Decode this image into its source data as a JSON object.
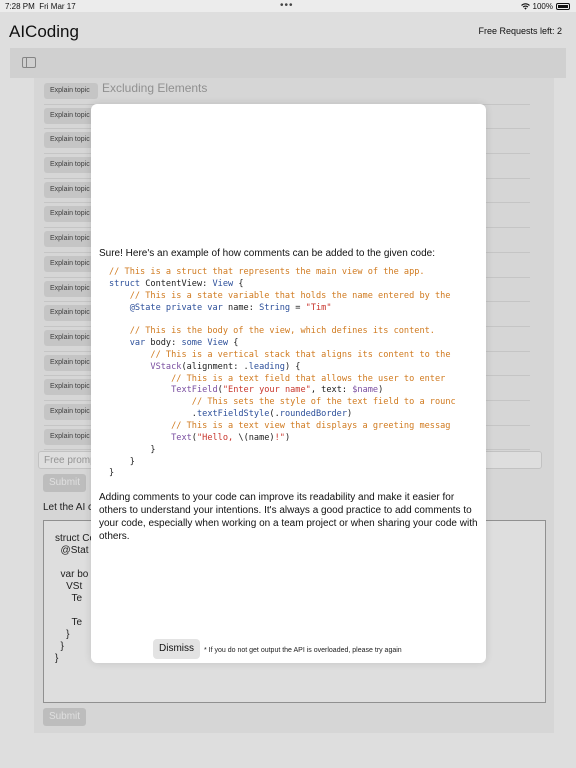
{
  "status_bar": {
    "time": "7:28 PM",
    "date": "Fri Mar 17",
    "battery": "100%"
  },
  "header": {
    "app_title": "AICoding",
    "free_requests": "Free Requests left: 2"
  },
  "topics": {
    "button_label": "Explain topic",
    "first_topic": "Excluding Elements",
    "row_count": 15
  },
  "free_prompt": {
    "placeholder": "Free promp"
  },
  "submit_label": "Submit",
  "let_ai_label": "Let the AI c",
  "background_code": [
    "struct Co",
    "  @Stat",
    "",
    "  var bo",
    "    VSt",
    "      Te",
    "",
    "      Te",
    "    }",
    "  }",
    "}"
  ],
  "modal": {
    "intro": "Sure! Here's an example of how comments can be added to the given code:",
    "code_lines": [
      [
        {
          "t": "c",
          "v": "// This is a struct that represents the main view of the app."
        }
      ],
      [
        {
          "t": "k",
          "v": "struct"
        },
        {
          "t": "n",
          "v": " ContentView: "
        },
        {
          "t": "t",
          "v": "View"
        },
        {
          "t": "n",
          "v": " {"
        }
      ],
      [
        {
          "t": "n",
          "v": "    "
        },
        {
          "t": "c",
          "v": "// This is a state variable that holds the name entered by the"
        }
      ],
      [
        {
          "t": "n",
          "v": "    "
        },
        {
          "t": "k",
          "v": "@State private var"
        },
        {
          "t": "n",
          "v": " name: "
        },
        {
          "t": "t",
          "v": "String"
        },
        {
          "t": "n",
          "v": " = "
        },
        {
          "t": "s",
          "v": "\"Tim\""
        }
      ],
      [
        {
          "t": "n",
          "v": ""
        }
      ],
      [
        {
          "t": "n",
          "v": "    "
        },
        {
          "t": "c",
          "v": "// This is the body of the view, which defines its content."
        }
      ],
      [
        {
          "t": "n",
          "v": "    "
        },
        {
          "t": "k",
          "v": "var"
        },
        {
          "t": "n",
          "v": " body: "
        },
        {
          "t": "k",
          "v": "some"
        },
        {
          "t": "n",
          "v": " "
        },
        {
          "t": "t",
          "v": "View"
        },
        {
          "t": "n",
          "v": " {"
        }
      ],
      [
        {
          "t": "n",
          "v": "        "
        },
        {
          "t": "c",
          "v": "// This is a vertical stack that aligns its content to the"
        }
      ],
      [
        {
          "t": "n",
          "v": "        "
        },
        {
          "t": "v",
          "v": "VStack"
        },
        {
          "t": "n",
          "v": "(alignment: ."
        },
        {
          "t": "p",
          "v": "leading"
        },
        {
          "t": "n",
          "v": ") {"
        }
      ],
      [
        {
          "t": "n",
          "v": "            "
        },
        {
          "t": "c",
          "v": "// This is a text field that allows the user to enter"
        }
      ],
      [
        {
          "t": "n",
          "v": "            "
        },
        {
          "t": "v",
          "v": "TextField"
        },
        {
          "t": "n",
          "v": "("
        },
        {
          "t": "s",
          "v": "\"Enter your name\""
        },
        {
          "t": "n",
          "v": ", text: "
        },
        {
          "t": "v",
          "v": "$name"
        },
        {
          "t": "n",
          "v": ")"
        }
      ],
      [
        {
          "t": "n",
          "v": "                "
        },
        {
          "t": "c",
          "v": "// This sets the style of the text field to a rounc"
        }
      ],
      [
        {
          "t": "n",
          "v": "                ."
        },
        {
          "t": "p",
          "v": "textFieldStyle"
        },
        {
          "t": "n",
          "v": "(."
        },
        {
          "t": "p",
          "v": "roundedBorder"
        },
        {
          "t": "n",
          "v": ")"
        }
      ],
      [
        {
          "t": "n",
          "v": "            "
        },
        {
          "t": "c",
          "v": "// This is a text view that displays a greeting messag"
        }
      ],
      [
        {
          "t": "n",
          "v": "            "
        },
        {
          "t": "v",
          "v": "Text"
        },
        {
          "t": "n",
          "v": "("
        },
        {
          "t": "s",
          "v": "\"Hello, "
        },
        {
          "t": "n",
          "v": "\\(name)"
        },
        {
          "t": "s",
          "v": "!\""
        },
        {
          "t": "n",
          "v": ")"
        }
      ],
      [
        {
          "t": "n",
          "v": "        }"
        }
      ],
      [
        {
          "t": "n",
          "v": "    }"
        }
      ],
      [
        {
          "t": "n",
          "v": "}"
        }
      ]
    ],
    "outro": "Adding comments to your code can improve its readability and make it easier for others to understand your intentions. It's always a good practice to add comments to your code, especially when working on a team project or when sharing your code with others.",
    "dismiss_label": "Dismiss",
    "footnote": "* If you do not get output the API is overloaded, please try again"
  },
  "colors": {
    "comment": "#d07a1f",
    "keyword": "#2c4f9a",
    "string": "#c8362d",
    "call": "#7a4ea0"
  }
}
